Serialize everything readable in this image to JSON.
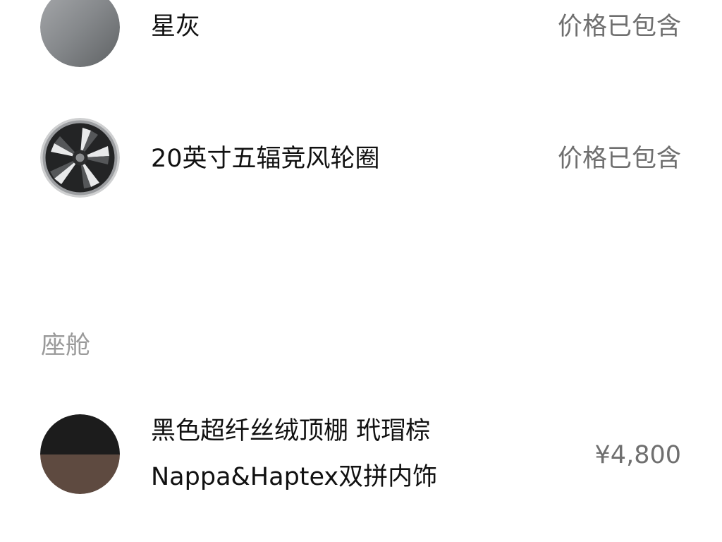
{
  "options": [
    {
      "name": "星灰",
      "price": "价格已包含",
      "swatch_color": "#85888b",
      "icon": "gray-paint-swatch"
    },
    {
      "name": "20英寸五辐竞风轮圈",
      "price": "价格已包含",
      "icon": "wheel-rim-icon"
    }
  ],
  "cabin_section": {
    "label": "座舱",
    "items": [
      {
        "name_line1": "黑色超纤丝绒顶棚 玳瑁棕",
        "name_line2": "Nappa&Haptex双拼内饰",
        "price": "¥4,800",
        "swatch_top_color": "#1c1c1c",
        "swatch_bottom_color": "#5e4a40",
        "icon": "interior-two-tone-swatch"
      }
    ]
  }
}
